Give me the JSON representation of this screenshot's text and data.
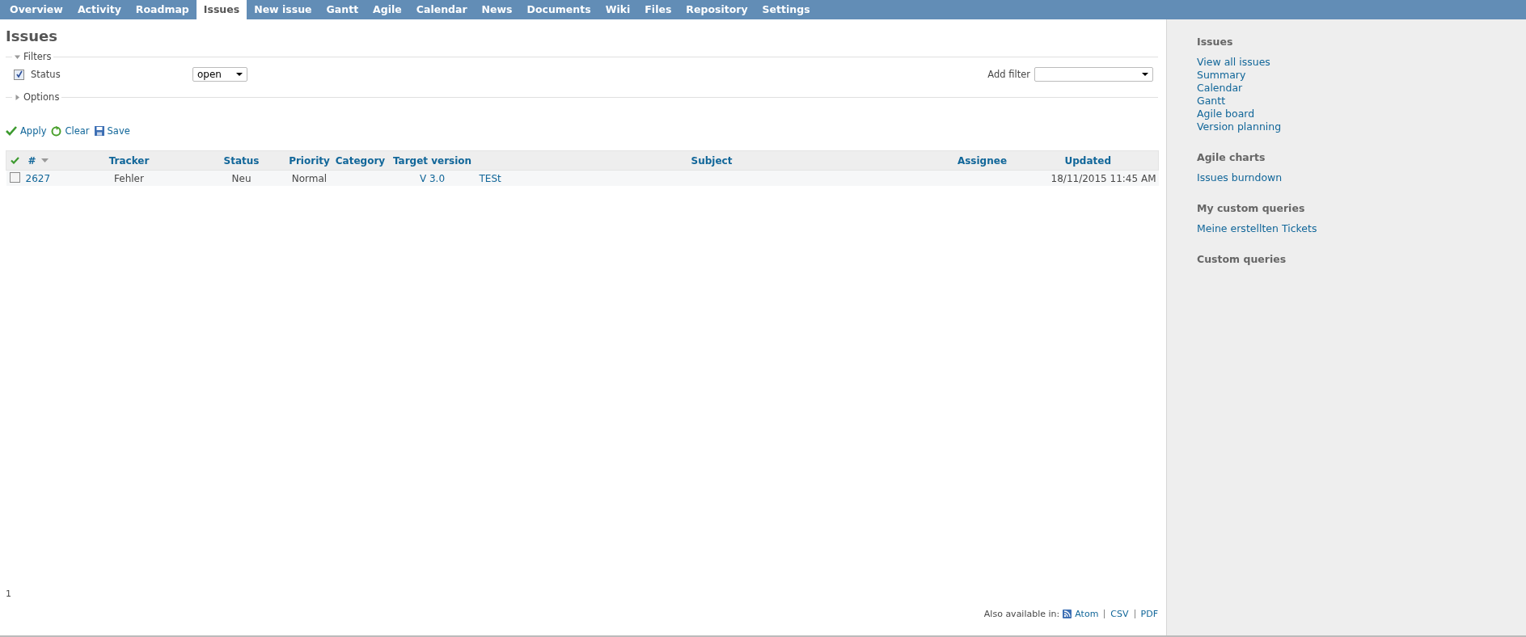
{
  "tabs": [
    {
      "label": "Overview",
      "selected": false
    },
    {
      "label": "Activity",
      "selected": false
    },
    {
      "label": "Roadmap",
      "selected": false
    },
    {
      "label": "Issues",
      "selected": true
    },
    {
      "label": "New issue",
      "selected": false
    },
    {
      "label": "Gantt",
      "selected": false
    },
    {
      "label": "Agile",
      "selected": false
    },
    {
      "label": "Calendar",
      "selected": false
    },
    {
      "label": "News",
      "selected": false
    },
    {
      "label": "Documents",
      "selected": false
    },
    {
      "label": "Wiki",
      "selected": false
    },
    {
      "label": "Files",
      "selected": false
    },
    {
      "label": "Repository",
      "selected": false
    },
    {
      "label": "Settings",
      "selected": false
    }
  ],
  "title": "Issues",
  "filters": {
    "legend": "Filters",
    "expanded": true,
    "items": [
      {
        "label": "Status",
        "checked": true,
        "operator": "open"
      }
    ],
    "add_filter_label": "Add filter"
  },
  "options": {
    "legend": "Options",
    "expanded": false
  },
  "actions": [
    "Apply",
    "Clear",
    "Save"
  ],
  "table": {
    "columns": [
      "#",
      "Tracker",
      "Status",
      "Priority",
      "Category",
      "Target version",
      "Subject",
      "Assignee",
      "Updated"
    ],
    "rows": [
      {
        "selected": false,
        "cells": [
          "2627",
          "Fehler",
          "Neu",
          "Normal",
          "",
          "V 3.0",
          "TESt",
          "",
          "18/11/2015 11:45 AM"
        ]
      }
    ]
  },
  "pagination": "1",
  "export": {
    "label": "Also available in:",
    "formats": [
      "Atom",
      "CSV",
      "PDF"
    ]
  },
  "sidebar": [
    {
      "heading": "Issues",
      "links": [
        "View all issues",
        "Summary",
        "Calendar",
        "Gantt",
        "Agile board",
        "Version planning"
      ]
    },
    {
      "heading": "Agile charts",
      "links": [
        "Issues burndown"
      ]
    },
    {
      "heading": "My custom queries",
      "links": [
        "Meine erstellten Tickets"
      ]
    },
    {
      "heading": "Custom queries"
    }
  ]
}
